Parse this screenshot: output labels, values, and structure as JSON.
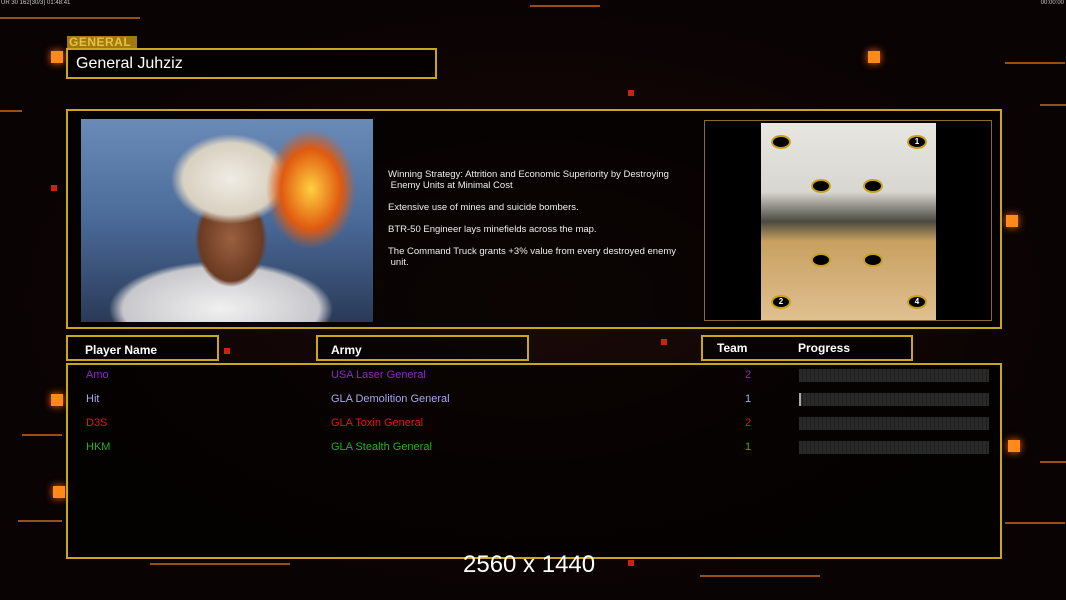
{
  "hud": {
    "left": "UR 30 162(30/3) 01:48:41",
    "right": "00:00:00"
  },
  "general": {
    "tag": "GENERAL",
    "name": "General Juhziz",
    "description": [
      "Winning Strategy: Attrition and Economic Superiority by Destroying\n Enemy Units at Minimal Cost",
      "Extensive use of mines and suicide bombers.",
      "BTR-50 Engineer lays minefields across the map.",
      "The Command Truck grants +3% value from every destroyed enemy\n unit."
    ]
  },
  "map": {
    "slots": [
      "1",
      "2",
      "4"
    ]
  },
  "columns": {
    "player": "Player Name",
    "army": "Army",
    "team": "Team",
    "progress": "Progress"
  },
  "players": [
    {
      "name": "Amo",
      "army": "USA Laser General",
      "team": "2",
      "progress": 0,
      "color": "#8a28c8"
    },
    {
      "name": "Hit",
      "army": "GLA Demolition General",
      "team": "1",
      "progress": 0.01,
      "color": "#a8a8e8"
    },
    {
      "name": "D3S",
      "army": "GLA Toxin General",
      "team": "2",
      "progress": 0,
      "color": "#e01818"
    },
    {
      "name": "HKM",
      "army": "GLA Stealth General",
      "team": "1",
      "progress": 0,
      "color": "#28b028"
    }
  ],
  "watermark": "2560 x 1440"
}
